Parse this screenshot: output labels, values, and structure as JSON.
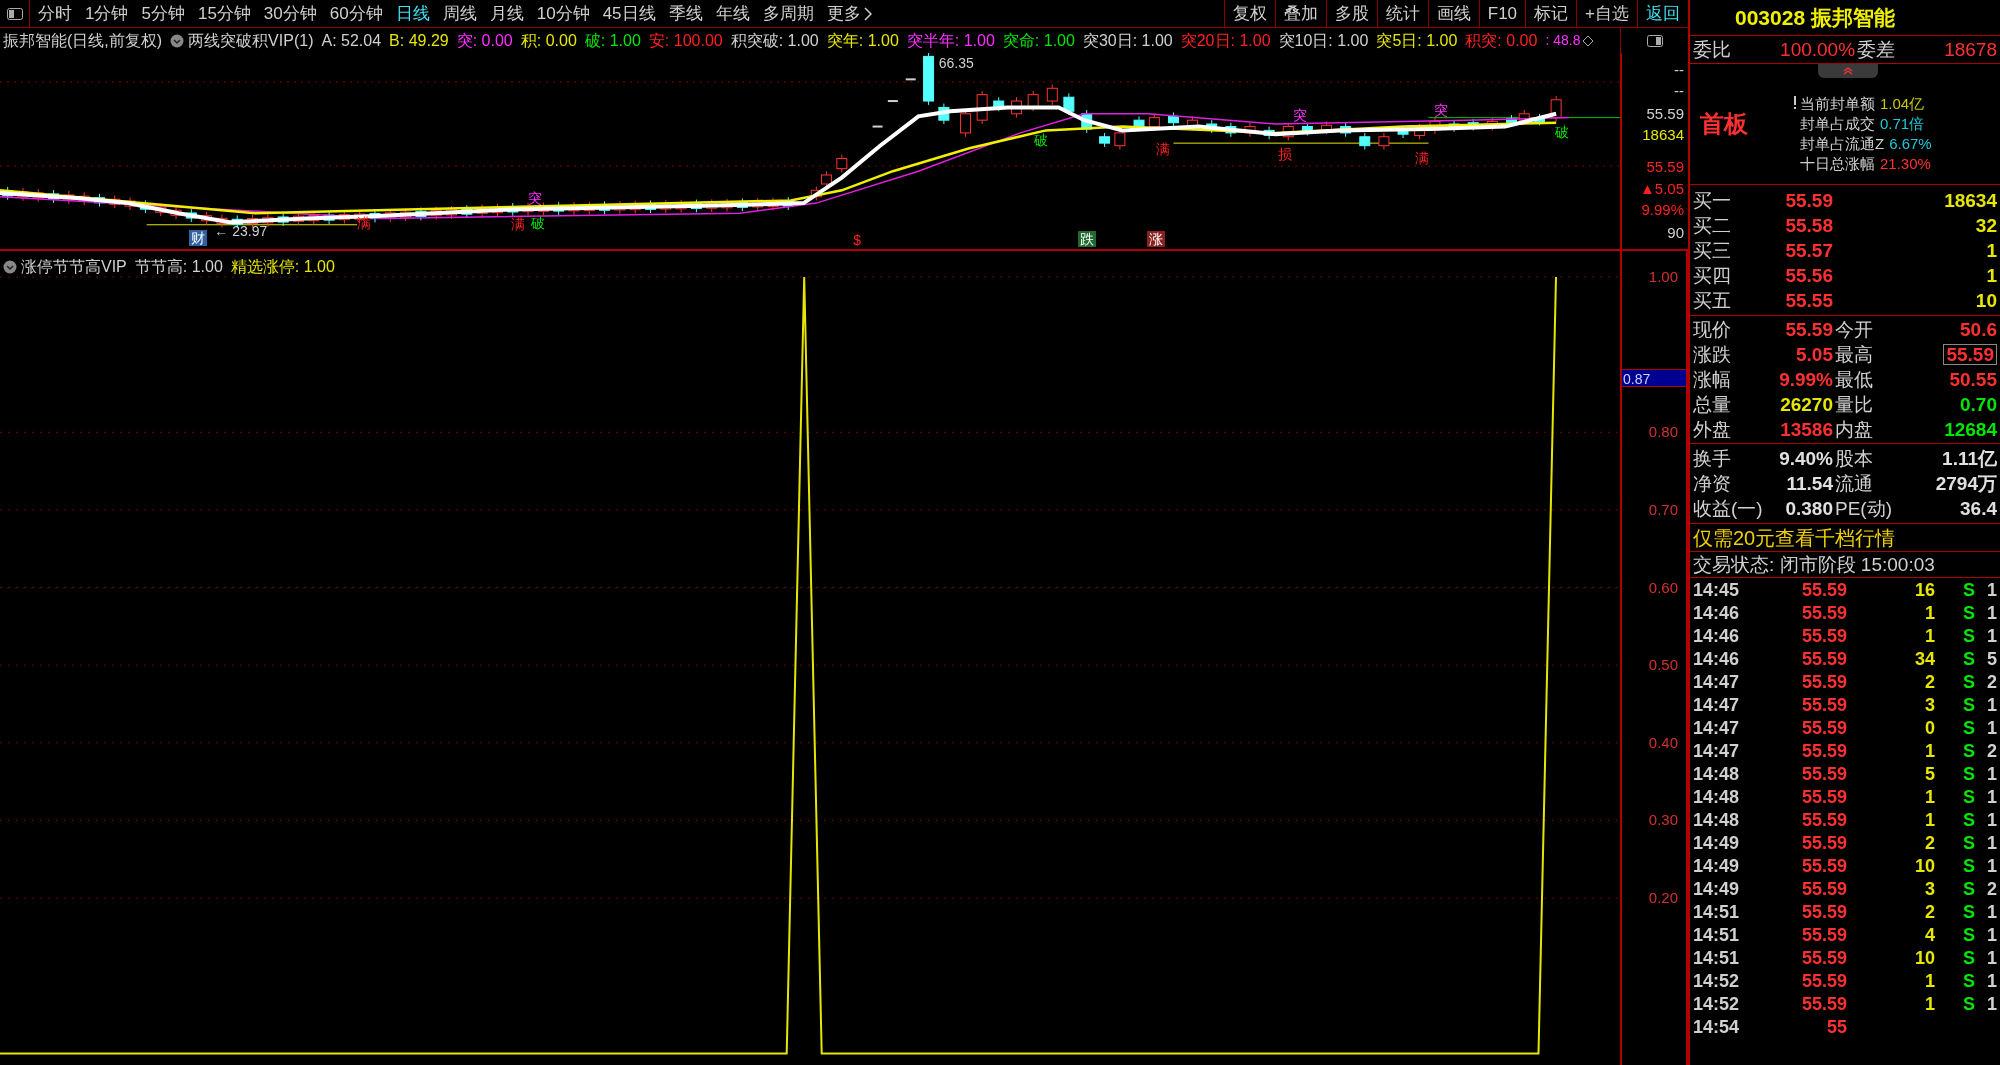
{
  "toolbar": {
    "periods": [
      {
        "label": "分时",
        "selected": false
      },
      {
        "label": "1分钟",
        "selected": false
      },
      {
        "label": "5分钟",
        "selected": false
      },
      {
        "label": "15分钟",
        "selected": false
      },
      {
        "label": "30分钟",
        "selected": false
      },
      {
        "label": "60分钟",
        "selected": false
      },
      {
        "label": "日线",
        "selected": true
      },
      {
        "label": "周线",
        "selected": false
      },
      {
        "label": "月线",
        "selected": false
      },
      {
        "label": "10分钟",
        "selected": false
      },
      {
        "label": "45日线",
        "selected": false
      },
      {
        "label": "季线",
        "selected": false
      },
      {
        "label": "年线",
        "selected": false
      },
      {
        "label": "多周期",
        "selected": false
      },
      {
        "label": "更多",
        "selected": false
      }
    ],
    "buttons": [
      {
        "label": "复权",
        "kind": "button"
      },
      {
        "label": "叠加",
        "kind": "button"
      },
      {
        "label": "多股",
        "kind": "button"
      },
      {
        "label": "统计",
        "kind": "button"
      },
      {
        "label": "画线",
        "kind": "button"
      },
      {
        "label": "F10",
        "kind": "button"
      },
      {
        "label": "标记",
        "kind": "button"
      },
      {
        "label": "+自选",
        "kind": "button"
      },
      {
        "label": "返回",
        "kind": "accent"
      }
    ]
  },
  "indicator_bar": {
    "title": "振邦智能(日线,前复权)",
    "indicator": "两线突破积VIP(1)",
    "values": [
      {
        "label": "A:",
        "value": "52.04",
        "color": "#d0d0d0"
      },
      {
        "label": "B:",
        "value": "49.29",
        "color": "#e6e600"
      },
      {
        "label": "突:",
        "value": "0.00",
        "color": "#ff30ff"
      },
      {
        "label": "积:",
        "value": "0.00",
        "color": "#e6e600"
      },
      {
        "label": "破:",
        "value": "1.00",
        "color": "#00e600"
      },
      {
        "label": "安:",
        "value": "100.00",
        "color": "#ff2020"
      },
      {
        "label": "积突破:",
        "value": "1.00",
        "color": "#d0d0d0"
      },
      {
        "label": "突年:",
        "value": "1.00",
        "color": "#e6e600"
      },
      {
        "label": "突半年:",
        "value": "1.00",
        "color": "#ff30ff"
      },
      {
        "label": "突命:",
        "value": "1.00",
        "color": "#00e600"
      },
      {
        "label": "突30日:",
        "value": "1.00",
        "color": "#d0d0d0"
      },
      {
        "label": "突20日:",
        "value": "1.00",
        "color": "#ff2020"
      },
      {
        "label": "突10日:",
        "value": "1.00",
        "color": "#d0d0d0"
      },
      {
        "label": "突5日:",
        "value": "1.00",
        "color": "#e6e600"
      },
      {
        "label": "积突:",
        "value": "0.00",
        "color": "#ff2020"
      }
    ],
    "trailing": ": 48.8"
  },
  "price_chart": {
    "markers": [
      {
        "text": "66.35",
        "color": "#d0d0d0",
        "kind": "plain"
      },
      {
        "text": "← 23.97",
        "color": "#d0d0d0",
        "kind": "plain"
      },
      {
        "text": "财",
        "color": "#3060a0",
        "kind": "boxed"
      },
      {
        "text": "满",
        "color": "#ff2020",
        "kind": "plain"
      },
      {
        "text": "突",
        "color": "#ff30ff",
        "kind": "plain"
      },
      {
        "text": "满",
        "color": "#ff2020",
        "kind": "plain"
      },
      {
        "text": "破",
        "color": "#00e600",
        "kind": "plain"
      },
      {
        "text": "$",
        "color": "#ff2020",
        "kind": "plain"
      },
      {
        "text": "破",
        "color": "#00e600",
        "kind": "plain"
      },
      {
        "text": "跌",
        "color": "#206a30",
        "kind": "boxed"
      },
      {
        "text": "涨",
        "color": "#8a2020",
        "kind": "boxed"
      },
      {
        "text": "满",
        "color": "#ff2020",
        "kind": "plain"
      },
      {
        "text": "损",
        "color": "#ff2020",
        "kind": "plain"
      },
      {
        "text": "突",
        "color": "#ff30ff",
        "kind": "plain"
      },
      {
        "text": "突",
        "color": "#ff30ff",
        "kind": "plain"
      },
      {
        "text": "满",
        "color": "#ff2020",
        "kind": "plain"
      },
      {
        "text": "破",
        "color": "#00e600",
        "kind": "plain"
      }
    ],
    "axis_labels": [
      {
        "text": "--",
        "color": "#d0d0d0"
      },
      {
        "text": "--",
        "color": "#d0d0d0"
      },
      {
        "text": "55.59",
        "color": "#d0d0d0"
      },
      {
        "text": "18634",
        "color": "#e6e600"
      },
      {
        "text": "55.59",
        "color": "#ff2020"
      },
      {
        "text": "▲5.05",
        "color": "#ff2020"
      },
      {
        "text": "9.99%",
        "color": "#ff2020"
      },
      {
        "text": "90",
        "color": "#d0d0d0"
      }
    ]
  },
  "indicator_chart": {
    "title": "涨停节节高VIP",
    "values": [
      {
        "label": "节节高:",
        "value": "1.00",
        "color": "#d0d0d0"
      },
      {
        "label": "精选涨停:",
        "value": "1.00",
        "color": "#e6e600"
      }
    ],
    "cursor_label": "0.87",
    "chart_data": {
      "type": "line",
      "ylim": [
        -0.015,
        1
      ],
      "grid": true,
      "yticks": [
        {
          "value": 0.2,
          "label": "0.20"
        },
        {
          "value": 0.3,
          "label": "0.30"
        },
        {
          "value": 0.4,
          "label": "0.40"
        },
        {
          "value": 0.5,
          "label": "0.50"
        },
        {
          "value": 0.6,
          "label": "0.60"
        },
        {
          "value": 0.7,
          "label": "0.70"
        },
        {
          "value": 0.8,
          "label": "0.80"
        },
        {
          "value": 1,
          "label": "1.00"
        }
      ],
      "series": [
        {
          "color": "#e6e600",
          "values": [
            0,
            0,
            0,
            0,
            0,
            0,
            0,
            0,
            0,
            0,
            0,
            0,
            0,
            0,
            0,
            0,
            0,
            0,
            0,
            0,
            0,
            0,
            0,
            0,
            0,
            0,
            0,
            0,
            0,
            0,
            0,
            0,
            0,
            0,
            0,
            0,
            0,
            0,
            0,
            0,
            0,
            0,
            0,
            0,
            0,
            0,
            1,
            0,
            0,
            0,
            0,
            0,
            0,
            0,
            0,
            0,
            0,
            0,
            0,
            0,
            0,
            0,
            0,
            0,
            0,
            0,
            0,
            0,
            0,
            0,
            0,
            0,
            0,
            0,
            0,
            0,
            0,
            0,
            0,
            0,
            0,
            0,
            0,
            0,
            0,
            0,
            0,
            0,
            0,
            1
          ]
        }
      ]
    }
  },
  "quote_panel": {
    "code": "003028",
    "name": "振邦智能",
    "ratio": {
      "label": "委比",
      "value": "100.00%",
      "label2": "委差",
      "value2": "18678"
    },
    "badge": "首板",
    "seal_info": [
      {
        "label": "当前封单额",
        "value": "1.04亿",
        "color": "#c8c800"
      },
      {
        "label": "封单占成交",
        "value": "0.71倍",
        "color": "#20c8d8"
      },
      {
        "label": "封单占流通Z",
        "value": "6.67%",
        "color": "#20c8d8"
      },
      {
        "label": "十日总涨幅",
        "value": "21.30%",
        "color": "#ff3030"
      }
    ],
    "bids": [
      {
        "label": "买一",
        "price": "55.59",
        "volume": "18634"
      },
      {
        "label": "买二",
        "price": "55.58",
        "volume": "32"
      },
      {
        "label": "买三",
        "price": "55.57",
        "volume": "1"
      },
      {
        "label": "买四",
        "price": "55.56",
        "volume": "1"
      },
      {
        "label": "买五",
        "price": "55.55",
        "volume": "10"
      }
    ],
    "quotes": [
      {
        "label": "现价",
        "value": "55.59",
        "color": "#ff3030",
        "right": {
          "label": "今开",
          "value": "50.6",
          "color": "#ff3030",
          "boxed": false
        }
      },
      {
        "label": "涨跌",
        "value": "5.05",
        "color": "#ff3030",
        "right": {
          "label": "最高",
          "value": "55.59",
          "color": "#ff3030",
          "boxed": true
        }
      },
      {
        "label": "涨幅",
        "value": "9.99%",
        "color": "#ff3030",
        "right": {
          "label": "最低",
          "value": "50.55",
          "color": "#ff3030",
          "boxed": false
        }
      },
      {
        "label": "总量",
        "value": "26270",
        "color": "#e6e600",
        "right": {
          "label": "量比",
          "value": "0.70",
          "color": "#00e600",
          "boxed": false
        }
      },
      {
        "label": "外盘",
        "value": "13586",
        "color": "#ff3030",
        "right": {
          "label": "内盘",
          "value": "12684",
          "color": "#00e600",
          "boxed": false
        }
      }
    ],
    "fundamentals": [
      {
        "label": "换手",
        "value": "9.40%",
        "label2": "股本",
        "value2": "1.11亿"
      },
      {
        "label": "净资",
        "value": "11.54",
        "label2": "流通",
        "value2": "2794万"
      },
      {
        "label": "收益(一)",
        "value": "0.380",
        "label2": "PE(动)",
        "value2": "36.4"
      }
    ],
    "promo": "仅需20元查看千档行情",
    "status": "交易状态: 闭市阶段 15:00:03",
    "ticks": [
      {
        "time": "14:45",
        "price": "55.59",
        "volume": "16",
        "side": "S",
        "count": "1"
      },
      {
        "time": "14:46",
        "price": "55.59",
        "volume": "1",
        "side": "S",
        "count": "1"
      },
      {
        "time": "14:46",
        "price": "55.59",
        "volume": "1",
        "side": "S",
        "count": "1"
      },
      {
        "time": "14:46",
        "price": "55.59",
        "volume": "34",
        "side": "S",
        "count": "5"
      },
      {
        "time": "14:47",
        "price": "55.59",
        "volume": "2",
        "side": "S",
        "count": "2"
      },
      {
        "time": "14:47",
        "price": "55.59",
        "volume": "3",
        "side": "S",
        "count": "1"
      },
      {
        "time": "14:47",
        "price": "55.59",
        "volume": "0",
        "side": "S",
        "count": "1"
      },
      {
        "time": "14:47",
        "price": "55.59",
        "volume": "1",
        "side": "S",
        "count": "2"
      },
      {
        "time": "14:48",
        "price": "55.59",
        "volume": "5",
        "side": "S",
        "count": "1"
      },
      {
        "time": "14:48",
        "price": "55.59",
        "volume": "1",
        "side": "S",
        "count": "1"
      },
      {
        "time": "14:48",
        "price": "55.59",
        "volume": "1",
        "side": "S",
        "count": "1"
      },
      {
        "time": "14:49",
        "price": "55.59",
        "volume": "2",
        "side": "S",
        "count": "1"
      },
      {
        "time": "14:49",
        "price": "55.59",
        "volume": "10",
        "side": "S",
        "count": "1"
      },
      {
        "time": "14:49",
        "price": "55.59",
        "volume": "3",
        "side": "S",
        "count": "2"
      },
      {
        "time": "14:51",
        "price": "55.59",
        "volume": "2",
        "side": "S",
        "count": "1"
      },
      {
        "time": "14:51",
        "price": "55.59",
        "volume": "4",
        "side": "S",
        "count": "1"
      },
      {
        "time": "14:51",
        "price": "55.59",
        "volume": "10",
        "side": "S",
        "count": "1"
      },
      {
        "time": "14:52",
        "price": "55.59",
        "volume": "1",
        "side": "S",
        "count": "1"
      },
      {
        "time": "14:52",
        "price": "55.59",
        "volume": "1",
        "side": "S",
        "count": "1"
      },
      {
        "time": "14:54",
        "price": "55"
      }
    ]
  }
}
